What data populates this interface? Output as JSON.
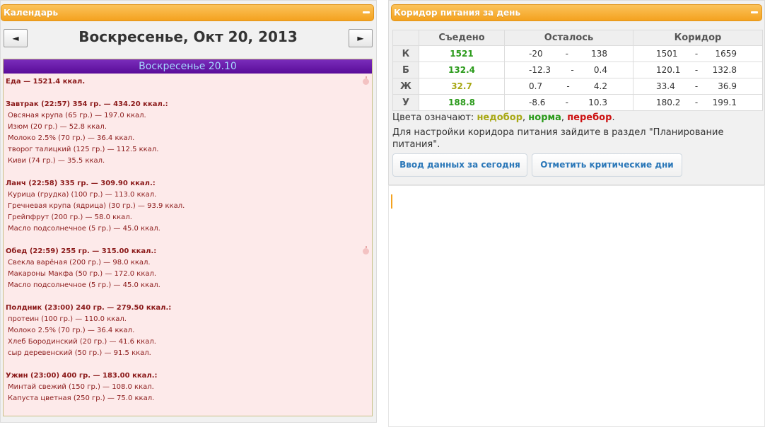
{
  "calendar": {
    "title": "Календарь",
    "prev_label": "◄",
    "next_label": "►",
    "date_title": "Воскресенье, Окт 20, 2013",
    "diary_header": "Воскресенье 20.10",
    "total": "Еда — 1521.4 ккал.",
    "meals": [
      {
        "title": "Завтрак (22:57) 354 гр. — 434.20 ккал.:",
        "items": [
          "Овсяная крупа (65 гр.) — 197.0 ккал.",
          "Изюм (20 гр.) — 52.8 ккал.",
          "Молоко 2.5% (70 гр.) — 36.4 ккал.",
          "творог талицкий (125 гр.) — 112.5 ккал.",
          "Киви (74 гр.) — 35.5 ккал."
        ]
      },
      {
        "title": "Ланч (22:58) 335 гр. — 309.90 ккал.:",
        "items": [
          "Курица (грудка) (100 гр.) — 113.0 ккал.",
          "Гречневая крупа (ядрица) (30 гр.) — 93.9 ккал.",
          "Грейпфрут (200 гр.) — 58.0 ккал.",
          "Масло подсолнечное (5 гр.) — 45.0 ккал."
        ]
      },
      {
        "title": "Обед (22:59) 255 гр. — 315.00 ккал.:",
        "items": [
          "Свекла варёная (200 гр.) — 98.0 ккал.",
          "Макароны Макфа (50 гр.) — 172.0 ккал.",
          "Масло подсолнечное (5 гр.) — 45.0 ккал."
        ]
      },
      {
        "title": "Полдник (23:00) 240 гр. — 279.50 ккал.:",
        "items": [
          "протеин (100 гр.) — 110.0 ккал.",
          "Молоко 2.5% (70 гр.) — 36.4 ккал.",
          "Хлеб Бородинский (20 гр.) — 41.6 ккал.",
          "сыр деревенский (50 гр.) — 91.5 ккал."
        ]
      },
      {
        "title": "Ужин (23:00) 400 гр. — 183.00 ккал.:",
        "items": [
          "Минтай свежий (150 гр.) — 108.0 ккал.",
          "Капуста цветная (250 гр.) — 75.0 ккал."
        ]
      }
    ]
  },
  "nutrition": {
    "title": "Коридор питания за день",
    "headers": [
      "Съедено",
      "Осталось",
      "Коридор"
    ],
    "dash": "-",
    "rows": [
      {
        "label": "К",
        "eaten": "1521",
        "rem_min": "-20",
        "rem_max": "138",
        "cor_min": "1501",
        "cor_max": "1659",
        "status": "norm"
      },
      {
        "label": "Б",
        "eaten": "132.4",
        "rem_min": "-12.3",
        "rem_max": "0.4",
        "cor_min": "120.1",
        "cor_max": "132.8",
        "status": "norm"
      },
      {
        "label": "Ж",
        "eaten": "32.7",
        "rem_min": "0.7",
        "rem_max": "4.2",
        "cor_min": "33.4",
        "cor_max": "36.9",
        "status": "under"
      },
      {
        "label": "У",
        "eaten": "188.8",
        "rem_min": "-8.6",
        "rem_max": "10.3",
        "cor_min": "180.2",
        "cor_max": "199.1",
        "status": "norm"
      }
    ],
    "legend": {
      "prefix": "Цвета означают:",
      "under": "недобор",
      "sep1": ",",
      "norm": "норма",
      "sep2": ",",
      "over": "перебор",
      "end": "."
    },
    "hint": "Для настройки коридора питания зайдите в раздел \"Планирование питания\".",
    "btn_today": "Ввод данных за сегодня",
    "btn_critical": "Отметить критические дни"
  },
  "colors": {
    "header_orange": "#f4a21f",
    "norm_green": "#2a9a1a",
    "under_olive": "#a8a814",
    "over_red": "#cc1111",
    "diary_purple": "#5a0c99"
  }
}
